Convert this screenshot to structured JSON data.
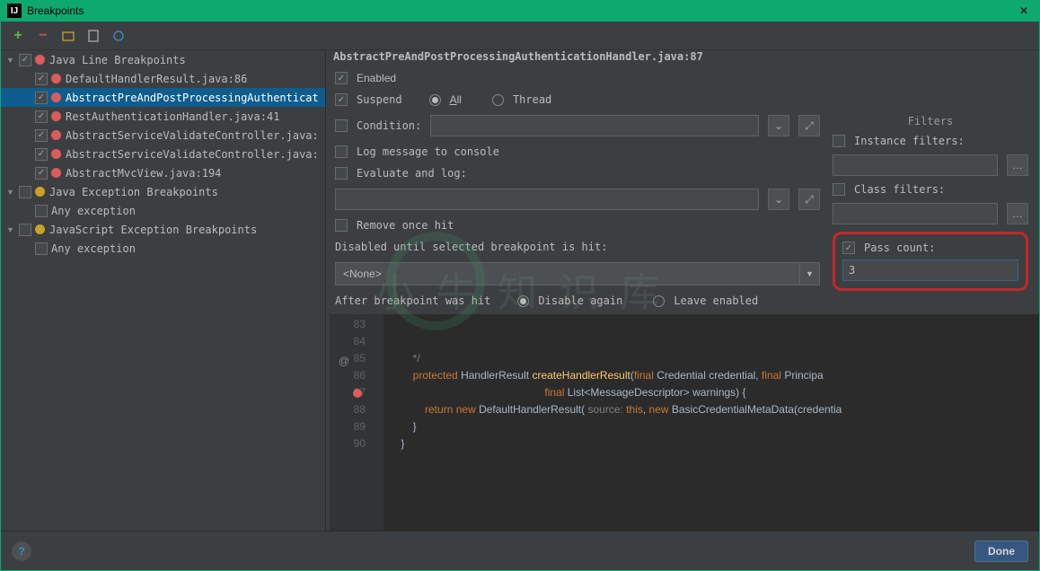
{
  "window": {
    "title": "Breakpoints",
    "close": "✕"
  },
  "toolbar": {
    "add": "+",
    "remove": "−"
  },
  "tree": {
    "groups": [
      {
        "name": "Java Line Breakpoints",
        "checked": true,
        "dot": "red",
        "items": [
          {
            "label": "DefaultHandlerResult.java:86",
            "checked": true
          },
          {
            "label": "AbstractPreAndPostProcessingAuthenticat",
            "checked": true,
            "selected": true
          },
          {
            "label": "RestAuthenticationHandler.java:41",
            "checked": true
          },
          {
            "label": "AbstractServiceValidateController.java:",
            "checked": true
          },
          {
            "label": "AbstractServiceValidateController.java:",
            "checked": true
          },
          {
            "label": "AbstractMvcView.java:194",
            "checked": true
          }
        ]
      },
      {
        "name": "Java Exception Breakpoints",
        "checked": false,
        "dot": "yellow",
        "items": [
          {
            "label": "Any exception",
            "checked": false
          }
        ]
      },
      {
        "name": "JavaScript Exception Breakpoints",
        "checked": false,
        "dot": "yellow",
        "items": [
          {
            "label": "Any exception",
            "checked": false
          }
        ]
      }
    ]
  },
  "details": {
    "header": "AbstractPreAndPostProcessingAuthenticationHandler.java:87",
    "enabled_label": "Enabled",
    "suspend_label": "Suspend",
    "suspend_all": "All",
    "suspend_thread": "Thread",
    "condition_label": "Condition:",
    "log_label": "Log message to console",
    "eval_label": "Evaluate and log:",
    "remove_label": "Remove once hit",
    "disabled_until": "Disabled until selected breakpoint is hit:",
    "select_value": "<None>",
    "after_hit": "After breakpoint was hit",
    "disable_again": "Disable again",
    "leave_enabled": "Leave enabled",
    "filters_title": "Filters",
    "instance_filters": "Instance filters:",
    "class_filters": "Class filters:",
    "pass_count": "Pass count:",
    "pass_count_value": "3"
  },
  "code": {
    "lines": [
      "83",
      "84",
      "85",
      "86",
      "87",
      "88",
      "89",
      "90"
    ],
    "l84": "        */",
    "l85_kw1": "protected",
    "l85_type": "HandlerResult",
    "l85_m": "createHandlerResult",
    "l85_kw2": "final",
    "l85_t2": "Credential",
    "l85_v2": "credential",
    "l85_kw3": "final",
    "l85_t3": "Principa",
    "l86_kw": "final",
    "l86_t": "List<MessageDescriptor>",
    "l86_v": "warnings",
    "l87_kw1": "return",
    "l87_kw2": "new",
    "l87_t": "DefaultHandlerResult",
    "l87_hint": "source:",
    "l87_this": "this",
    "l87_kw3": "new",
    "l87_t2": "BasicCredentialMetaData",
    "l87_v": "credentia",
    "l88": "        }",
    "l89": "    }"
  },
  "footer": {
    "done": "Done"
  }
}
